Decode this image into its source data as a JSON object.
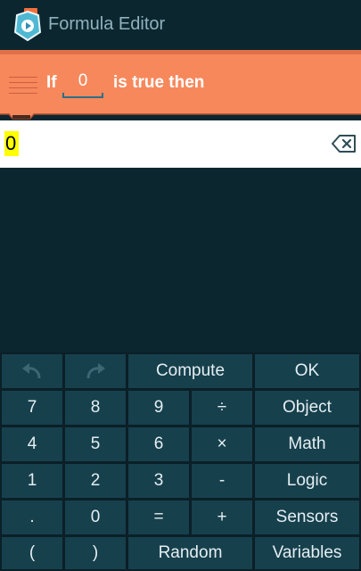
{
  "app": {
    "title": "Formula Editor",
    "icon": "pocket-code-logo-icon"
  },
  "brick": {
    "prefix": "If",
    "field_value": "0",
    "suffix": "is true then",
    "color": "#f7885c"
  },
  "formula": {
    "text": "0",
    "highlight_color": "#ffff00"
  },
  "keyboard": {
    "undo_icon": "undo-icon",
    "redo_icon": "redo-icon",
    "compute": "Compute",
    "ok": "OK",
    "k7": "7",
    "k8": "8",
    "k9": "9",
    "divide": "÷",
    "object": "Object",
    "k4": "4",
    "k5": "5",
    "k6": "6",
    "multiply": "×",
    "math": "Math",
    "k1": "1",
    "k2": "2",
    "k3": "3",
    "minus": "-",
    "logic": "Logic",
    "dot": ".",
    "k0": "0",
    "equals": "=",
    "plus": "+",
    "sensors": "Sensors",
    "open_paren": "(",
    "close_paren": ")",
    "random": "Random",
    "variables": "Variables"
  }
}
